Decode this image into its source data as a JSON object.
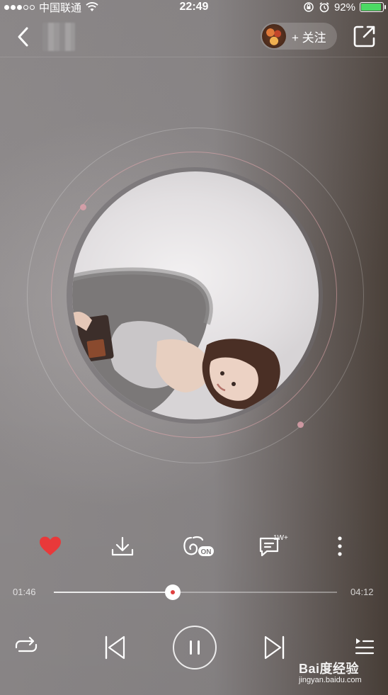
{
  "status_bar": {
    "carrier": "中国联通",
    "time": "22:49",
    "battery": "92%",
    "battery_level": 0.92
  },
  "header": {
    "follow_label": "+ 关注"
  },
  "actions": {
    "comment_count": "1W+",
    "effect_badge": "ON"
  },
  "progress": {
    "elapsed": "01:46",
    "total": "04:12",
    "fraction": 0.42
  },
  "watermark": {
    "logo": "Bai度经验",
    "url": "jingyan.baidu.com"
  },
  "colors": {
    "like_red": "#e8393a",
    "accent_ring": "#e6aab0",
    "battery_green": "#4cd964"
  },
  "icons": {
    "back": "chevron-left-icon",
    "share": "share-icon",
    "like": "heart-icon",
    "download": "download-icon",
    "effect": "sound-effect-icon",
    "comment": "comment-icon",
    "more": "more-vertical-icon",
    "loop": "loop-icon",
    "prev": "skip-previous-icon",
    "play_pause": "pause-icon",
    "next": "skip-next-icon",
    "playlist": "playlist-icon"
  }
}
